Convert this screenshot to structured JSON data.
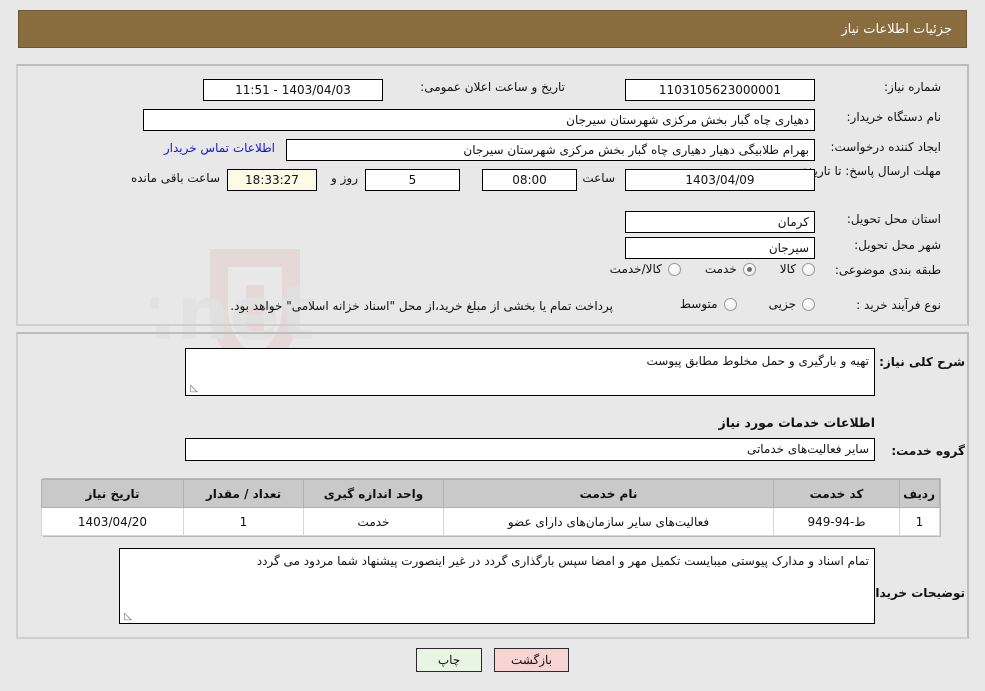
{
  "header": {
    "title": "جزئیات اطلاعات نیاز"
  },
  "top_panel": {
    "need_number_label": "شماره نیاز:",
    "need_number_value": "1103105623000001",
    "announce_datetime_label": "تاریخ و ساعت اعلان عمومی:",
    "announce_datetime_value": "1403/04/03 - 11:51",
    "buyer_org_label": "نام دستگاه خریدار:",
    "buyer_org_value": "دهیاری چاه گبار بخش مرکزی شهرستان سیرجان",
    "requester_label": "ایجاد کننده درخواست:",
    "requester_value": "بهرام طلابیگی دهیار دهیاری چاه گبار بخش مرکزی شهرستان سیرجان",
    "contact_link": "اطلاعات تماس خریدار",
    "deadline_label": "مهلت ارسال پاسخ: تا تاریخ:",
    "deadline_date": "1403/04/09",
    "deadline_hour_label": "ساعت",
    "deadline_hour": "08:00",
    "days_remaining": "5",
    "days_unit_label": "روز و",
    "countdown": "18:33:27",
    "countdown_label": "ساعت باقی مانده",
    "province_label": "استان محل تحویل:",
    "province_value": "کرمان",
    "city_label": "شهر محل تحویل:",
    "city_value": "سیرجان",
    "category_label": "طبقه بندی موضوعی:",
    "category_options": [
      {
        "label": "کالا",
        "selected": false
      },
      {
        "label": "خدمت",
        "selected": true
      },
      {
        "label": "کالا/خدمت",
        "selected": false
      }
    ],
    "process_label": "نوع فرآیند خرید :",
    "process_options": [
      {
        "label": "جزیی",
        "selected": false
      },
      {
        "label": "متوسط",
        "selected": false
      }
    ],
    "process_note": "پرداخت تمام یا بخشی از مبلغ خرید،از محل \"اسناد خزانه اسلامی\" خواهد بود."
  },
  "bottom_panel": {
    "need_desc_label": "شرح کلی نیاز:",
    "need_desc_value": "تهیه و بارگیری و حمل مخلوط مطابق پیوست",
    "services_heading": "اطلاعات خدمات مورد نیاز",
    "service_group_label": "گروه خدمت:",
    "service_group_value": "سایر فعالیت‌های خدماتی",
    "table": {
      "columns": [
        "ردیف",
        "کد خدمت",
        "نام خدمت",
        "واحد اندازه گیری",
        "تعداد / مقدار",
        "تاریخ نیاز"
      ],
      "rows": [
        {
          "row_no": "1",
          "service_code": "ط-94-949",
          "service_name": "فعالیت‌های سایر سازمان‌های دارای عضو",
          "unit": "خدمت",
          "quantity": "1",
          "need_date": "1403/04/20"
        }
      ]
    },
    "buyer_notes_label": "توضیحات خریدار:",
    "buyer_notes_value": "تمام اسناد و مدارک پیوستی میبایست تکمیل مهر و امضا سپس بارگذاری گردد در غیر اینصورت پیشنهاد شما مردود می گردد"
  },
  "footer": {
    "back_button": "بازگشت",
    "print_button": "چاپ"
  },
  "watermark": {
    "text": "AriaTender.net"
  }
}
